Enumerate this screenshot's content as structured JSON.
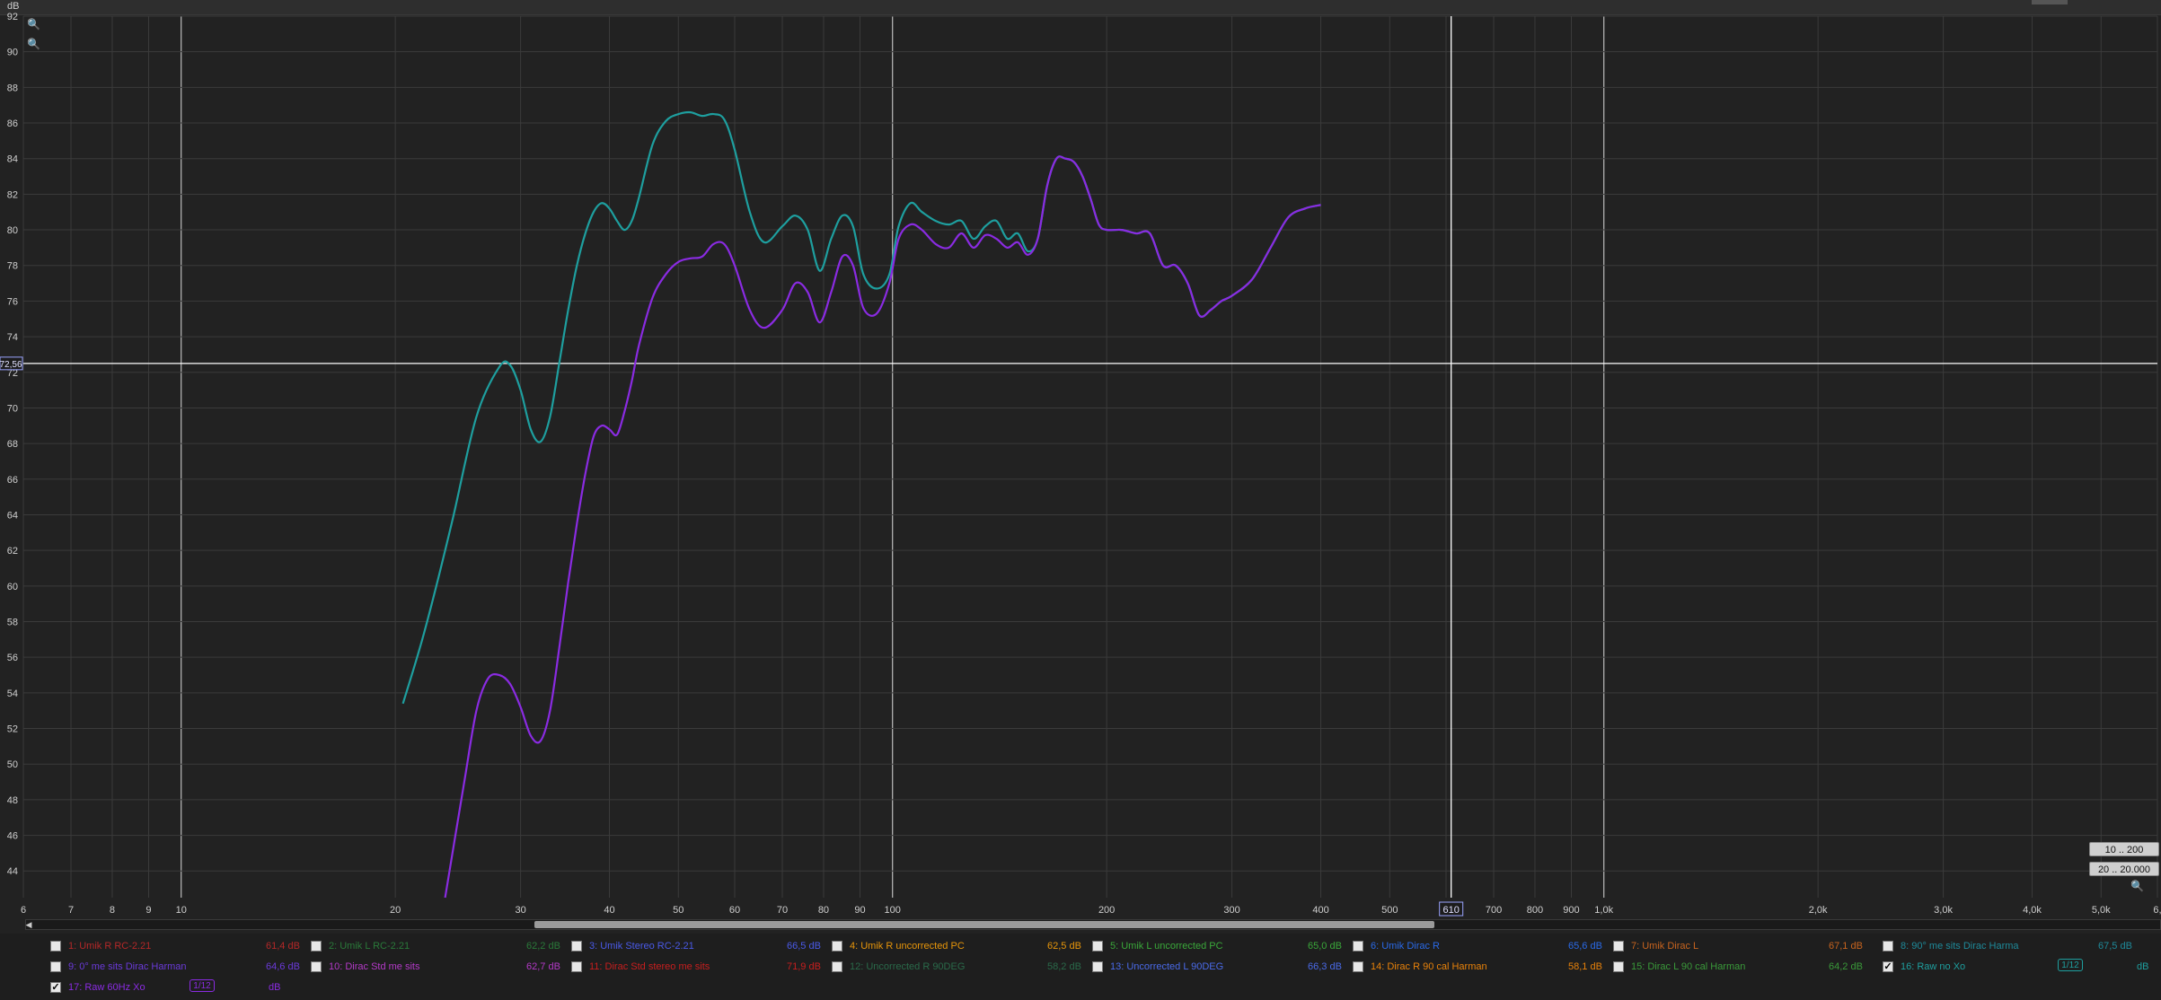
{
  "top": {
    "unit": "dB"
  },
  "chart_data": {
    "type": "line",
    "xscale": "log",
    "xlim": [
      6,
      6000
    ],
    "ylim": [
      42.5,
      92
    ],
    "y_unit": "dB",
    "y_ticks": [
      44,
      46,
      48,
      50,
      52,
      54,
      56,
      58,
      60,
      62,
      64,
      66,
      68,
      70,
      72,
      74,
      76,
      78,
      80,
      82,
      84,
      86,
      88,
      90,
      92
    ],
    "x_ticks": [
      {
        "v": 6,
        "l": "6"
      },
      {
        "v": 7,
        "l": "7"
      },
      {
        "v": 8,
        "l": "8"
      },
      {
        "v": 9,
        "l": "9"
      },
      {
        "v": 10,
        "l": "10"
      },
      {
        "v": 20,
        "l": "20"
      },
      {
        "v": 30,
        "l": "30"
      },
      {
        "v": 40,
        "l": "40"
      },
      {
        "v": 50,
        "l": "50"
      },
      {
        "v": 60,
        "l": "60"
      },
      {
        "v": 70,
        "l": "70"
      },
      {
        "v": 80,
        "l": "80"
      },
      {
        "v": 90,
        "l": "90"
      },
      {
        "v": 100,
        "l": "100"
      },
      {
        "v": 200,
        "l": "200"
      },
      {
        "v": 300,
        "l": "300"
      },
      {
        "v": 400,
        "l": "400"
      },
      {
        "v": 500,
        "l": "500"
      },
      {
        "v": 700,
        "l": "700"
      },
      {
        "v": 800,
        "l": "800"
      },
      {
        "v": 900,
        "l": "900"
      },
      {
        "v": 1000,
        "l": "1,0k"
      },
      {
        "v": 2000,
        "l": "2,0k"
      },
      {
        "v": 3000,
        "l": "3,0k"
      },
      {
        "v": 4000,
        "l": "4,0k"
      },
      {
        "v": 5000,
        "l": "5,0k"
      },
      {
        "v": 6000,
        "l": "6,"
      }
    ],
    "major_x": [
      10,
      100,
      1000
    ],
    "cursor": {
      "x": 610,
      "x_label": "610",
      "y": 72.5,
      "y_label": "72,56"
    },
    "series": [
      {
        "name": "16: Raw no Xo",
        "color": "#1e9f9f",
        "x": [
          20.5,
          22,
          24,
          26,
          28,
          29,
          30,
          31,
          32,
          33,
          34,
          35,
          36,
          37,
          38,
          39,
          40,
          41,
          42,
          43,
          44,
          46,
          48,
          50,
          52,
          54,
          56,
          58,
          60,
          63,
          66,
          70,
          73,
          76,
          79,
          82,
          85,
          88,
          91,
          95,
          99,
          102,
          106,
          110,
          115,
          120,
          125,
          130,
          135,
          140,
          145,
          150,
          155,
          160,
          165,
          170,
          175,
          180,
          185,
          190,
          195,
          200,
          210,
          220,
          230,
          240,
          250,
          260,
          270,
          280,
          290,
          300,
          320,
          340,
          360,
          380,
          400
        ],
        "y": [
          53.4,
          57.5,
          63.5,
          69.5,
          72.3,
          72.4,
          71,
          68.8,
          68.1,
          69.5,
          72.5,
          75.5,
          78,
          79.8,
          81,
          81.5,
          81.2,
          80.5,
          80,
          80.5,
          81.8,
          84.8,
          86.1,
          86.5,
          86.6,
          86.4,
          86.5,
          86.2,
          84.5,
          81,
          79.3,
          80.2,
          80.8,
          80,
          77.7,
          79.5,
          80.8,
          80.2,
          77.5,
          76.7,
          77.5,
          80.2,
          81.5,
          81,
          80.5,
          80.3,
          80.5,
          79.5,
          80.2,
          80.5,
          79.5,
          79.8,
          78.8,
          79.5,
          82.5,
          84,
          84,
          83.8,
          83,
          81.7,
          80.3,
          80,
          80,
          79.8,
          79.8,
          78,
          78,
          77,
          75.2,
          75.5,
          76,
          76.3,
          77.2,
          79,
          80.7,
          81.2,
          81.4
        ]
      },
      {
        "name": "17: Raw 60Hz Xo",
        "color": "#8a2be2",
        "x": [
          23.5,
          25,
          26,
          27,
          28,
          29,
          30,
          31,
          32,
          33,
          34,
          35,
          36,
          37,
          38,
          39,
          40,
          41,
          42,
          43,
          44,
          46,
          48,
          50,
          52,
          54,
          56,
          58,
          60,
          63,
          66,
          70,
          73,
          76,
          79,
          82,
          85,
          88,
          91,
          95,
          99,
          102,
          106,
          110,
          115,
          120,
          125,
          130,
          135,
          140,
          145,
          150,
          155,
          160,
          165,
          170,
          175,
          180,
          185,
          190,
          195,
          200,
          210,
          220,
          230,
          240,
          250,
          260,
          270,
          280,
          290,
          300,
          320,
          340,
          360,
          380,
          400
        ],
        "y": [
          42.5,
          49,
          53,
          54.8,
          55,
          54.5,
          53.2,
          51.6,
          51.3,
          53,
          56.5,
          60.2,
          63.5,
          66.3,
          68.4,
          69,
          68.8,
          68.5,
          69.8,
          71.5,
          73.5,
          76.2,
          77.5,
          78.2,
          78.4,
          78.5,
          79.2,
          79.2,
          78,
          75.5,
          74.5,
          75.5,
          77,
          76.5,
          74.8,
          76.5,
          78.5,
          78,
          75.6,
          75.3,
          77,
          79.5,
          80.3,
          80,
          79.2,
          79,
          79.8,
          79,
          79.7,
          79.5,
          79,
          79.3,
          78.6,
          79.5,
          82.5,
          84,
          84,
          83.8,
          83,
          81.7,
          80.3,
          80,
          80,
          79.8,
          79.8,
          78,
          78,
          77,
          75.2,
          75.5,
          76,
          76.3,
          77.2,
          79,
          80.7,
          81.2,
          81.4
        ]
      }
    ]
  },
  "controls": {
    "range1": "10 .. 200",
    "range2": "20 .. 20.000",
    "zoom_in_icon": "zoom-in-icon",
    "zoom_out_icon": "zoom-out-icon"
  },
  "legend": {
    "row1": [
      {
        "name": "1: Umik R RC-2.21",
        "val": "61,4 dB",
        "color": "#b42828",
        "checked": false
      },
      {
        "name": "2: Umik L RC-2.21",
        "val": "62,2 dB",
        "color": "#2a7a3a",
        "checked": false
      },
      {
        "name": "3: Umik Stereo RC-2.21",
        "val": "66,5 dB",
        "color": "#4a5ae8",
        "checked": false
      },
      {
        "name": "4: Umik R uncorrected PC",
        "val": "62,5 dB",
        "color": "#e8960a",
        "checked": false
      },
      {
        "name": "5: Umik L uncorrected PC",
        "val": "65,0 dB",
        "color": "#3aa83a",
        "checked": false
      },
      {
        "name": "6: Umik Dirac R",
        "val": "65,6 dB",
        "color": "#2a6ae8",
        "checked": false
      },
      {
        "name": "7: Umik Dirac L",
        "val": "67,1 dB",
        "color": "#c8641e",
        "checked": false
      },
      {
        "name": "8: 90° me sits Dirac Harma",
        "val": "67,5 dB",
        "color": "#1e8a9a",
        "checked": false
      }
    ],
    "row2": [
      {
        "name": "9: 0° me sits Dirac Harman",
        "val": "64,6 dB",
        "color": "#6a3ad8",
        "checked": false
      },
      {
        "name": "10: Dirac Std me sits",
        "val": "62,7 dB",
        "color": "#b43ac8",
        "checked": false
      },
      {
        "name": "11: Dirac Std stereo me sits",
        "val": "71,9 dB",
        "color": "#c81e1e",
        "checked": false
      },
      {
        "name": "12: Uncorrected R 90DEG",
        "val": "58,2 dB",
        "color": "#2a6a4a",
        "checked": false
      },
      {
        "name": "13: Uncorrected L 90DEG",
        "val": "66,3 dB",
        "color": "#4a6ae8",
        "checked": false
      },
      {
        "name": "14: Dirac R 90 cal Harman",
        "val": "58,1 dB",
        "color": "#e8820a",
        "checked": false
      },
      {
        "name": "15: Dirac L 90 cal Harman",
        "val": "64,2 dB",
        "color": "#3a9a3a",
        "checked": false
      },
      {
        "name": "16: Raw no Xo",
        "val": "dB",
        "color": "#1e9f9f",
        "checked": true,
        "frac": "1/12"
      }
    ],
    "row3": [
      {
        "name": "17: Raw 60Hz Xo",
        "val": "dB",
        "color": "#8a2be2",
        "checked": true,
        "frac": "1/12"
      }
    ]
  }
}
